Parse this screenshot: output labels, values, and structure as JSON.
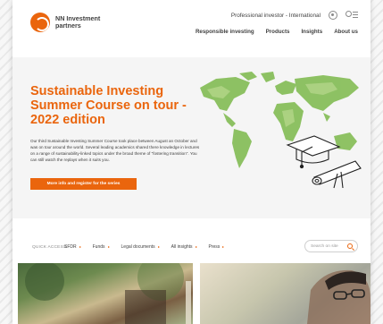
{
  "brand": {
    "line1": "NN Investment",
    "line2": "partners",
    "accent_color": "#ea650d"
  },
  "header": {
    "audience": "Professional investor - International",
    "icons": [
      "user-icon",
      "search-menu-icon"
    ],
    "nav": [
      {
        "label": "Responsible investing"
      },
      {
        "label": "Products"
      },
      {
        "label": "Insights"
      },
      {
        "label": "About us"
      }
    ]
  },
  "hero": {
    "title": "Sustainable Investing Summer Course on tour - 2022 edition",
    "body": "Our third Sustainable Investing Summer Course took place between August an October and was on tour around the world. Several leading academics shared there knowledge in lectures on a range of sustainability-linked topics under the broad theme of \"fostering transition\". You can still watch the replays when it suits you.",
    "cta_label": "More info and register for the series"
  },
  "quick_access": {
    "label": "QUICK ACCESS:",
    "links": [
      {
        "label": "SFDR"
      },
      {
        "label": "Funds"
      },
      {
        "label": "Legal documents"
      },
      {
        "label": "All insights"
      },
      {
        "label": "Press"
      }
    ],
    "search_placeholder": "Search on site"
  }
}
